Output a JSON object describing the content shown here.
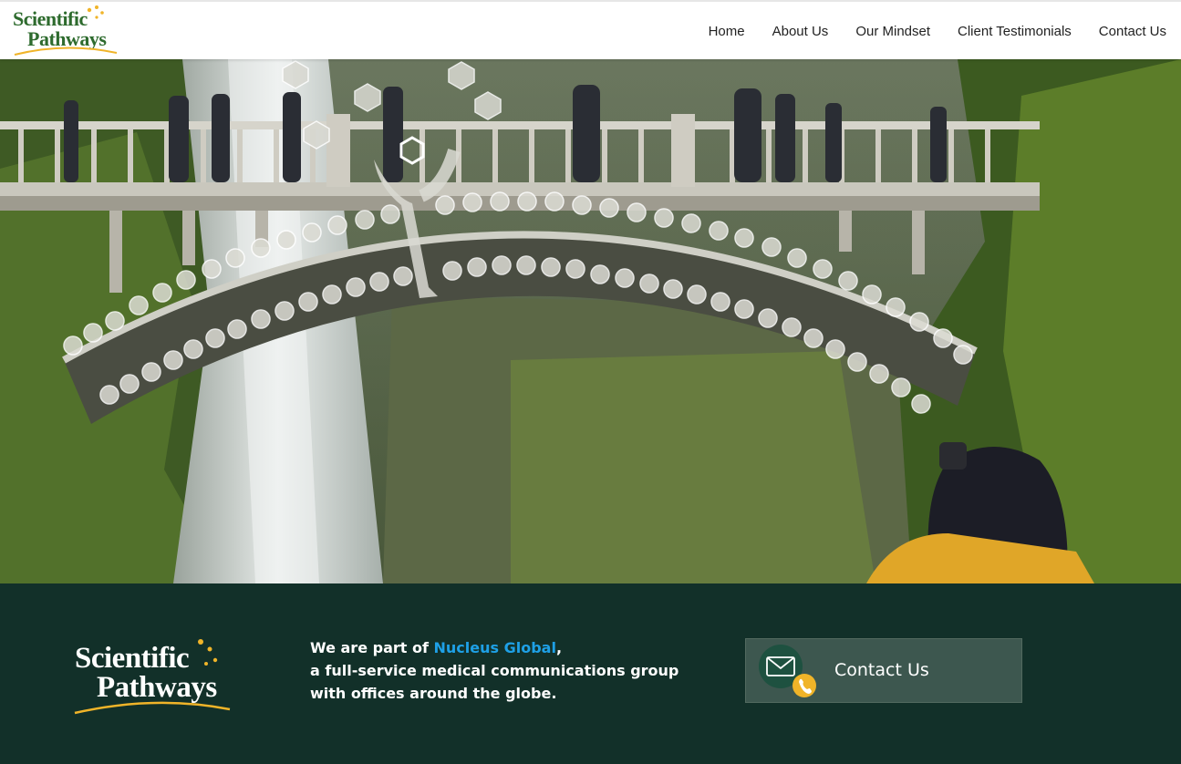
{
  "header": {
    "logo_line1": "Scientific",
    "logo_line2": "Pathways",
    "nav": [
      "Home",
      "About Us",
      "Our Mindset",
      "Client Testimonials",
      "Contact Us"
    ]
  },
  "footer": {
    "logo_line1": "Scientific",
    "logo_line2": "Pathways",
    "tagline_prefix": "We are part of ",
    "tagline_link": "Nucleus Global",
    "tagline_comma": ",",
    "tagline_rest": "a full-service medical communications group with offices around the globe.",
    "contact_label": "Contact Us"
  },
  "colors": {
    "brand_green": "#2e6b2e",
    "footer_bg": "#123029",
    "link_blue": "#1ea0e6",
    "accent_yellow": "#f0b429",
    "contact_box": "#3d574f"
  },
  "icons": {
    "contact": "envelope-phone-icon"
  }
}
